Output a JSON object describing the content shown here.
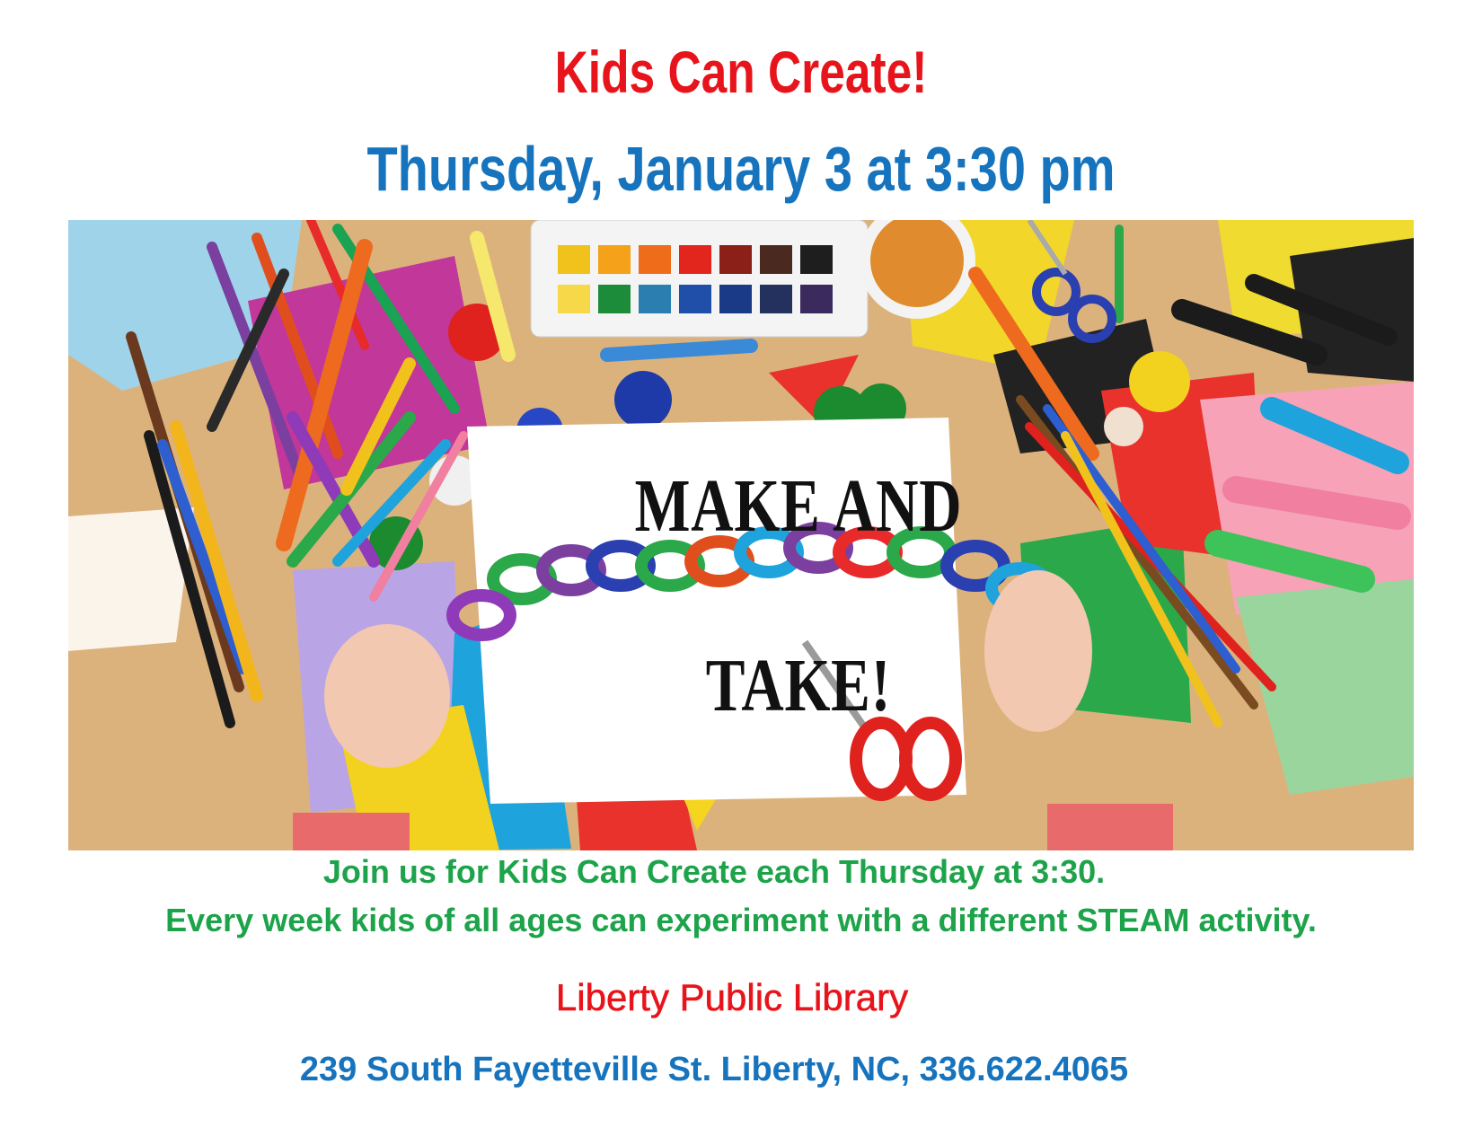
{
  "flyer": {
    "title": "Kids Can Create!",
    "datetime": "Thursday, January 3 at 3:30 pm",
    "photo": {
      "overlay_line1": "MAKE AND",
      "overlay_line2": "TAKE!"
    },
    "description_line1": "Join us for Kids Can Create each Thursday at 3:30.",
    "description_line2": "Every week kids of all ages can experiment with a different STEAM activity.",
    "library_name": "Liberty Public Library",
    "address": "239 South Fayetteville St. Liberty, NC, 336.622.4065"
  },
  "colors": {
    "title_red": "#e8141b",
    "date_blue": "#1673bd",
    "text_green": "#1da34a",
    "address_blue": "#1673bd"
  }
}
